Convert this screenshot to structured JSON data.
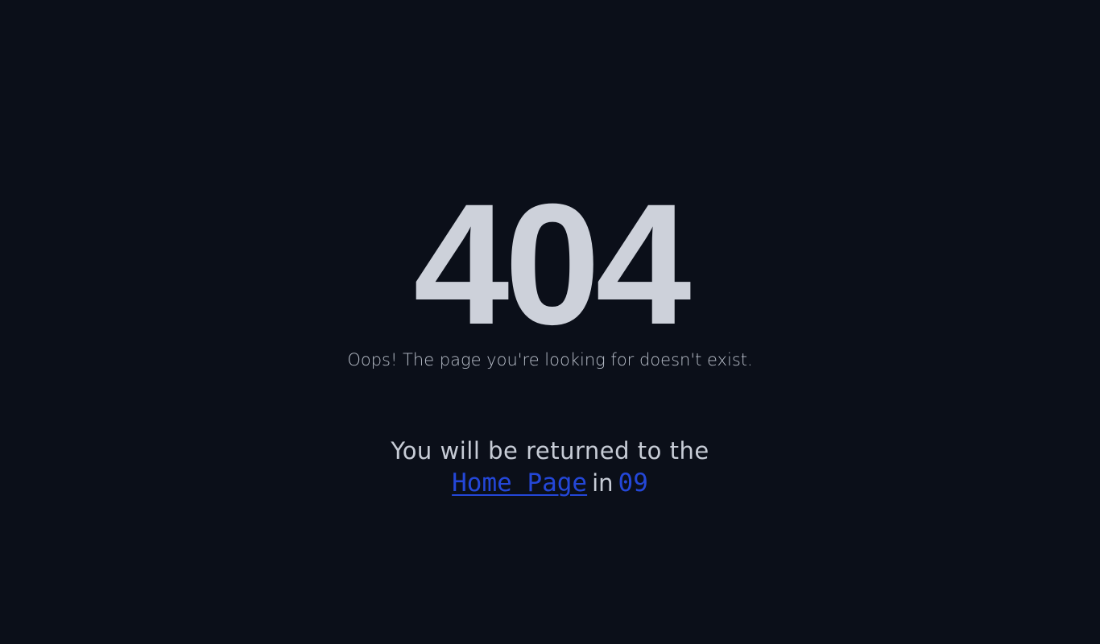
{
  "error": {
    "code": "404",
    "message": "Oops! The page you're looking for doesn't exist."
  },
  "redirect": {
    "prefix": "You will be returned to the",
    "link_label": "Home Page",
    "in_word": "in",
    "countdown": "09"
  },
  "colors": {
    "background": "#0b0f19",
    "code_text": "#cdd1da",
    "accent": "#2447d8"
  }
}
